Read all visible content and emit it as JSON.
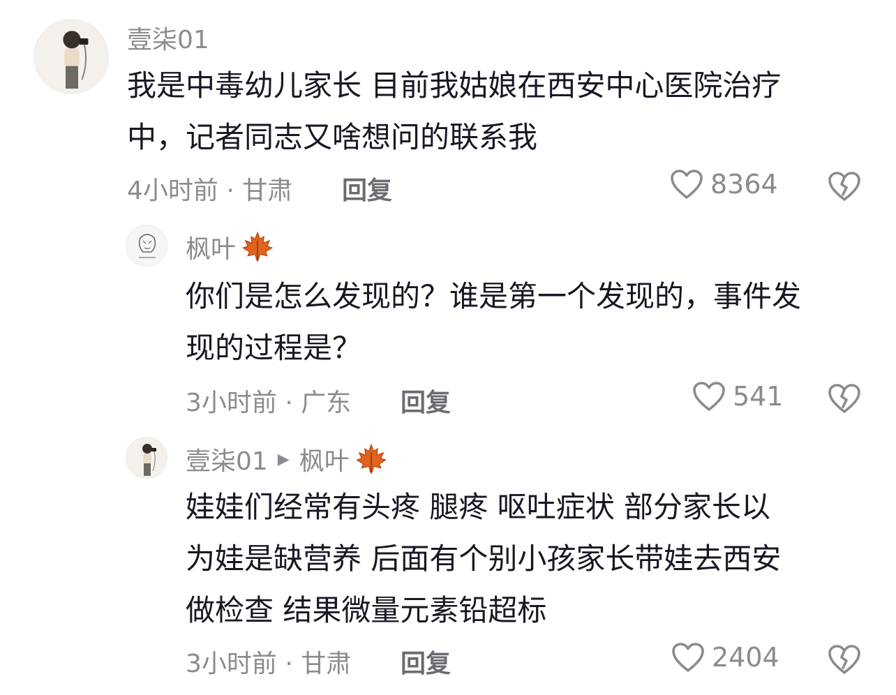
{
  "comments": [
    {
      "username": "壹柒01",
      "text_lines": [
        "我是中毒幼儿家长  目前我姑娘在西安中心医院治疗",
        "中，记者同志又啥想问的联系我"
      ],
      "meta": "4小时前 · 甘肃",
      "reply_label": "回复",
      "likes": "8364"
    },
    {
      "username": "枫叶",
      "text_lines": [
        "你们是怎么发现的？谁是第一个发现的，事件发",
        "现的过程是？"
      ],
      "meta": "3小时前 · 广东",
      "reply_label": "回复",
      "likes": "541"
    },
    {
      "username": "壹柒01",
      "reply_to": "枫叶",
      "text_lines": [
        "娃娃们经常有头疼  腿疼  呕吐症状  部分家长以",
        "为娃是缺营养  后面有个别小孩家长带娃去西安",
        "做检查  结果微量元素铅超标"
      ],
      "meta": "3小时前 · 甘肃",
      "reply_label": "回复",
      "likes": "2404"
    }
  ],
  "icons": {
    "like": "heart-outline-icon",
    "dislike": "broken-heart-icon",
    "reply_arrow": "play-triangle-icon",
    "badge": "maple-leaf-icon"
  },
  "colors": {
    "text": "#161823",
    "secondary": "#8a8b91",
    "maple": "#e0641b"
  }
}
